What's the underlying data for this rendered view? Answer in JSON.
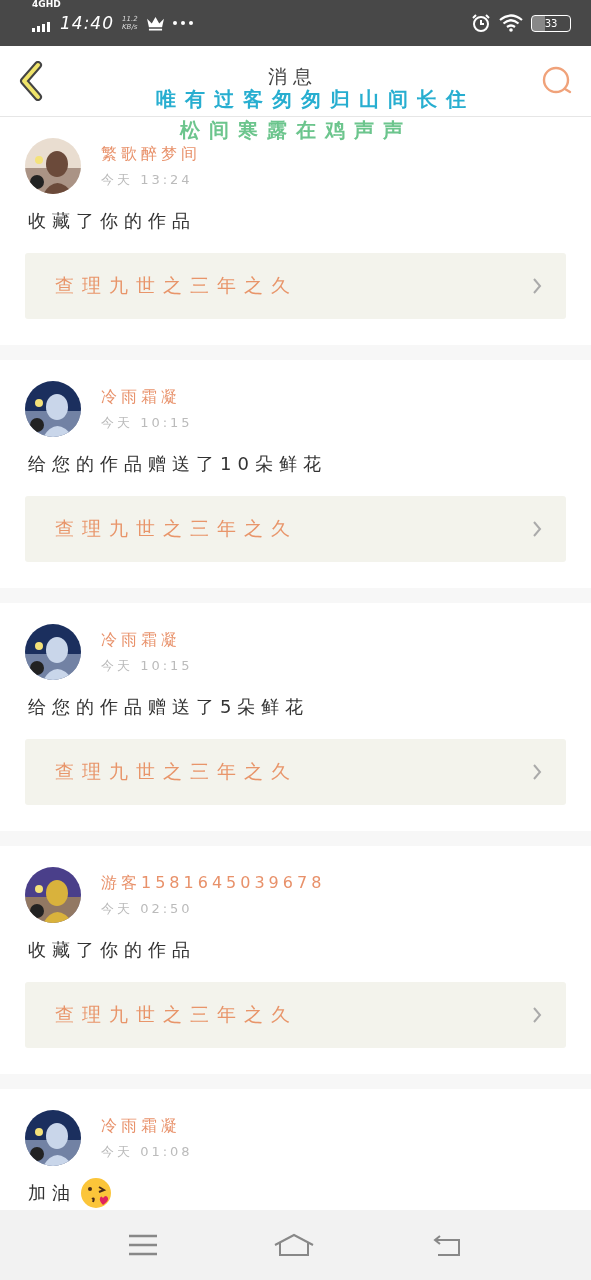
{
  "status_bar": {
    "network": "4GHD",
    "time": "14:40",
    "speed": "11.2",
    "speed_unit": "KB/s",
    "battery": "33"
  },
  "header": {
    "title": "消息"
  },
  "overlay": [
    "唯有过客匆匆归山间长住",
    "松间寒露在鸡声声"
  ],
  "messages": [
    {
      "name": "繁歌醉梦间",
      "time": "今天 13:24",
      "text": "收藏了你的作品",
      "work": "查理九世之三年之久"
    },
    {
      "name": "冷雨霜凝",
      "time": "今天 10:15",
      "text": "给您的作品赠送了10朵鲜花",
      "work": "查理九世之三年之久"
    },
    {
      "name": "冷雨霜凝",
      "time": "今天 10:15",
      "text": "给您的作品赠送了5朵鲜花",
      "work": "查理九世之三年之久"
    },
    {
      "name": "游客1581645039678",
      "time": "今天 02:50",
      "text": "收藏了你的作品",
      "work": "查理九世之三年之久"
    },
    {
      "name": "冷雨霜凝",
      "time": "今天 01:08",
      "text": "加油",
      "emoji": true
    }
  ]
}
